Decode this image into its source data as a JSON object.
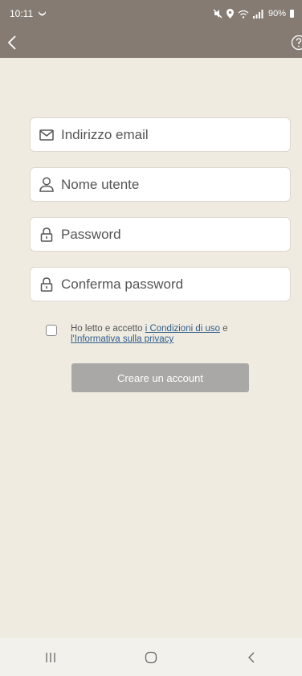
{
  "status_bar": {
    "time": "10:11",
    "battery": "90%"
  },
  "app_bar": {
    "back_icon": "chevron-left-icon",
    "help_icon": "help-circle-icon"
  },
  "form": {
    "email": {
      "placeholder": "Indirizzo email",
      "icon": "mail-icon"
    },
    "username": {
      "placeholder": "Nome utente",
      "icon": "user-icon"
    },
    "password": {
      "placeholder": "Password",
      "icon": "lock-icon"
    },
    "confirm_password": {
      "placeholder": "Conferma password",
      "icon": "lock-icon"
    }
  },
  "terms": {
    "prefix": "Ho letto e accetto ",
    "conditions_link": "i Condizioni di uso",
    "joiner": " e ",
    "privacy_link": "l'Informativa sulla privacy"
  },
  "create_button": {
    "label": "Creare un account"
  },
  "colors": {
    "header": "#857b72",
    "background": "#efebe1",
    "button": "#a9a8a6",
    "link": "#2f5d8a"
  }
}
